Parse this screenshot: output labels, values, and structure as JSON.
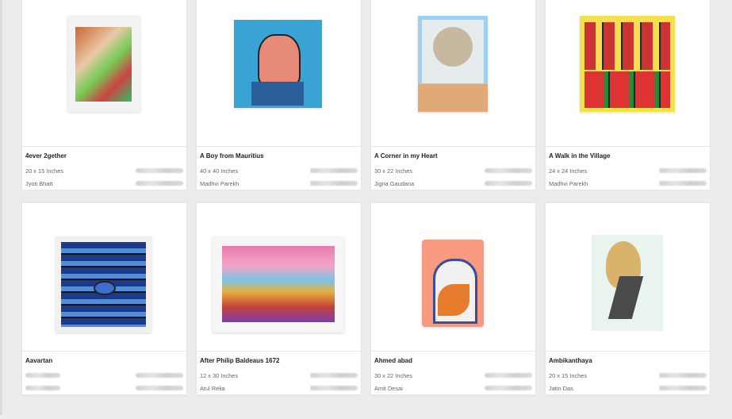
{
  "cards": [
    {
      "title": "4ever 2gether",
      "size": "20 x 15 Inches",
      "artist": "Jyoti Bhatt",
      "bg": "#f1f1f1",
      "accent": "#c44"
    },
    {
      "title": "A Boy from Mauritius",
      "size": "40 x 40 Inches",
      "artist": "Madhvi Parekh",
      "bg": "#3aa5d6",
      "accent": "#d9a"
    },
    {
      "title": "A Corner in my Heart",
      "size": "30 x 22 Inches",
      "artist": "Jigna Gaudana",
      "bg": "#e8eef0",
      "accent": "#c9a"
    },
    {
      "title": "A Walk in the Village",
      "size": "24 x 24 Inches",
      "artist": "Madhvi Parekh",
      "bg": "#f6e23a",
      "accent": "#c33"
    },
    {
      "title": "Aavartan",
      "size": "",
      "artist": "",
      "bg": "#1c2a6b",
      "accent": "#4aa"
    },
    {
      "title": "After Philip Baldeaus 1672",
      "size": "12 x 30 Inches",
      "artist": "Atul Relia",
      "bg": "#f3a0c0",
      "accent": "#5bd"
    },
    {
      "title": "Ahmed abad",
      "size": "30 x 22 Inches",
      "artist": "Amit Desai",
      "bg": "#f59a7e",
      "accent": "#e8a"
    },
    {
      "title": "Ambikanthaya",
      "size": "20 x 15 Inches",
      "artist": "Jatin Das",
      "bg": "#e6f1ea",
      "accent": "#a77"
    }
  ]
}
